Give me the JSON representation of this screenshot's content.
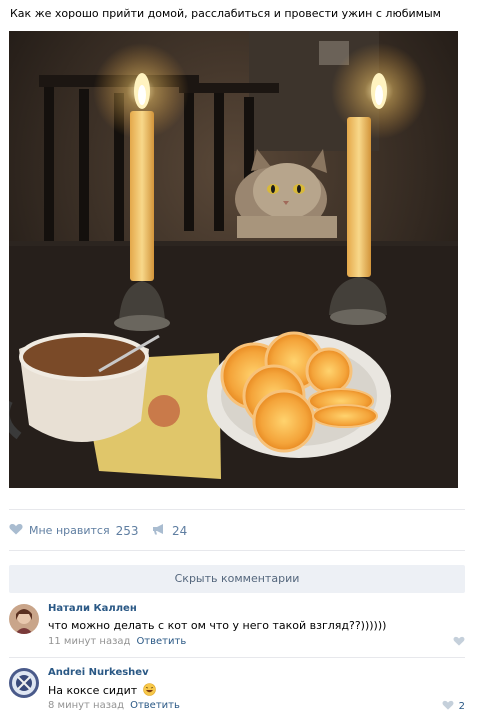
{
  "post": {
    "text": "Как же хорошо прийти домой, расслабиться и провести ужин с любимым"
  },
  "actions": {
    "like_label": "Мне нравится",
    "like_count": "253",
    "share_count": "24"
  },
  "comments_toggle": "Скрыть комментарии",
  "comments": [
    {
      "author": "Натали Каллен",
      "text": "что можно делать с кот ом что у него такой взгляд??))))))",
      "time": "11 минут назад",
      "reply": "Ответить",
      "likes": ""
    },
    {
      "author": "Andrei Nurkeshev",
      "text": "На коксе сидит",
      "emoji": "laughing-emoji",
      "time": "8 минут назад",
      "reply": "Ответить",
      "likes": "2"
    }
  ],
  "colors": {
    "link": "#2a5885",
    "action": "#5f7ea1",
    "muted": "#939393",
    "button_bg": "#edf0f5"
  },
  "icons": {
    "like": "heart-icon",
    "share": "megaphone-icon",
    "comment_like": "heart-icon"
  }
}
